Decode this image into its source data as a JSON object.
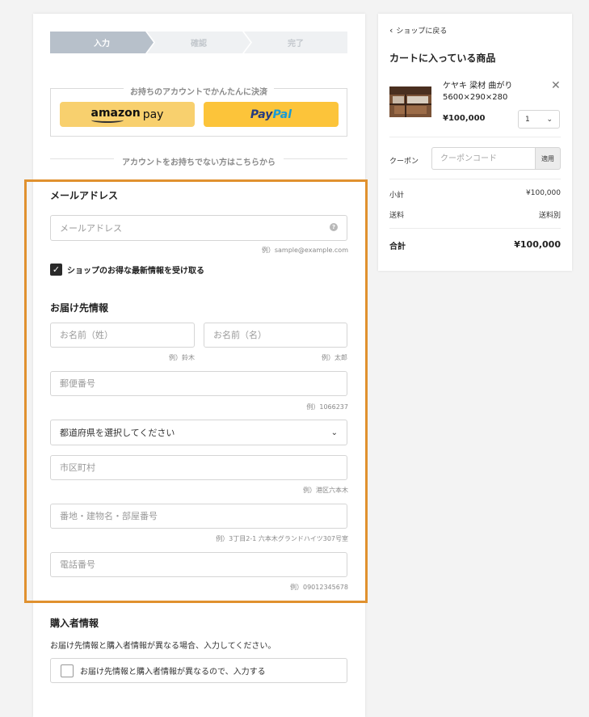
{
  "steps": [
    "入力",
    "確認",
    "完了"
  ],
  "account": {
    "title": "お持ちのアカウントでかんたんに決済",
    "amazon_main": "amazon",
    "amazon_pay": "pay",
    "paypal_1": "Pay",
    "paypal_2": "Pal"
  },
  "no_account_text": "アカウントをお持ちでない方はこちらから",
  "email": {
    "title": "メールアドレス",
    "placeholder": "メールアドレス",
    "hint": "例）sample@example.com",
    "newsletter_label": "ショップのお得な最新情報を受け取る"
  },
  "shipping": {
    "title": "お届け先情報",
    "last_name_placeholder": "お名前（姓）",
    "last_name_hint": "例）鈴木",
    "first_name_placeholder": "お名前（名）",
    "first_name_hint": "例）太郎",
    "postal_placeholder": "郵便番号",
    "postal_hint": "例）1066237",
    "prefecture_selected": "都道府県を選択してください",
    "city_placeholder": "市区町村",
    "city_hint": "例）港区六本木",
    "address_placeholder": "番地・建物名・部屋番号",
    "address_hint": "例）3丁目2-1 六本木グランドハイツ307号室",
    "phone_placeholder": "電話番号",
    "phone_hint": "例）09012345678"
  },
  "purchaser": {
    "title": "購入者情報",
    "description": "お届け先情報と購入者情報が異なる場合、入力してください。",
    "checkbox_label": "お届け先情報と購入者情報が異なるので、入力する"
  },
  "cart": {
    "back_link": "ショップに戻る",
    "title": "カートに入っている商品",
    "product_name": "ケヤキ 梁材 曲がり 5600×290×280",
    "price": "¥100,000",
    "quantity": "1",
    "coupon_label": "クーポン",
    "coupon_placeholder": "クーポンコード",
    "coupon_apply": "適用",
    "subtotal_label": "小計",
    "subtotal_value": "¥100,000",
    "shipping_label": "送料",
    "shipping_value": "送料別",
    "total_label": "合計",
    "total_value": "¥100,000"
  },
  "colors": {
    "highlight": "#e0912f",
    "amazon": "#f8d06e",
    "paypal": "#fcc43a",
    "step_active": "#b7c0ca"
  }
}
